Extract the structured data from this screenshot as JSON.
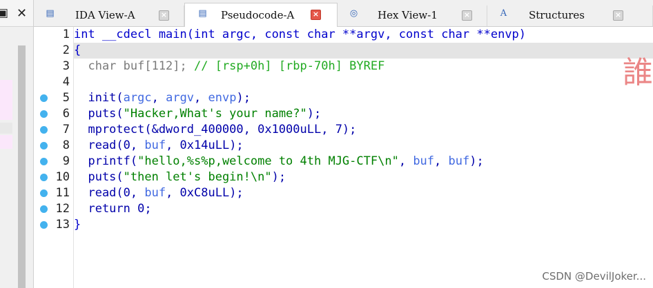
{
  "left_panel": {
    "pin_glyph": "▣",
    "close_glyph": "✕"
  },
  "tabs": [
    {
      "label": "IDA View-A",
      "icon": "ida-view-icon",
      "glyph": "▤",
      "active": false,
      "close": "×"
    },
    {
      "label": "Pseudocode-A",
      "icon": "pseudocode-icon",
      "glyph": "▤",
      "active": true,
      "close": "×"
    },
    {
      "label": "Hex View-1",
      "icon": "hex-view-icon",
      "glyph": "◎",
      "active": false,
      "close": "×"
    },
    {
      "label": "Structures",
      "icon": "structures-icon",
      "glyph": "A",
      "active": false,
      "close": "×"
    }
  ],
  "code_lines": [
    {
      "num": "1",
      "text": "int __cdecl main(int argc, const char **argv, const char **envp)",
      "bp": false,
      "kind": "plain"
    },
    {
      "num": "2",
      "text": "{",
      "bp": false,
      "kind": "plain"
    },
    {
      "num": "3",
      "text": "  char buf[112]; ",
      "comment": "// [rsp+0h] [rbp-70h] BYREF",
      "bp": false,
      "kind": "decl"
    },
    {
      "num": "4",
      "text": "",
      "bp": false,
      "kind": "plain"
    },
    {
      "num": "5",
      "text": "  init(argc, argv, envp);",
      "bp": true,
      "kind": "code"
    },
    {
      "num": "6",
      "text": "  puts(\"Hacker,What's your name?\");",
      "bp": true,
      "kind": "code"
    },
    {
      "num": "7",
      "text": "  mprotect(&dword_400000, 0x1000uLL, 7);",
      "bp": true,
      "kind": "code"
    },
    {
      "num": "8",
      "text": "  read(0, buf, 0x14uLL);",
      "bp": true,
      "kind": "code"
    },
    {
      "num": "9",
      "text": "  printf(\"hello,%s%p,welcome to 4th MJG-CTF\\n\", buf, buf);",
      "bp": true,
      "kind": "code"
    },
    {
      "num": "10",
      "text": "  puts(\"then let's begin!\\n\");",
      "bp": true,
      "kind": "code"
    },
    {
      "num": "11",
      "text": "  read(0, buf, 0xC8uLL);",
      "bp": true,
      "kind": "code"
    },
    {
      "num": "12",
      "text": "  return 0;",
      "bp": true,
      "kind": "code"
    },
    {
      "num": "13",
      "text": "}",
      "bp": true,
      "kind": "plain"
    }
  ],
  "watermark": "CSDN @DevilJoker...",
  "corner_glyph": "誰",
  "colors": {
    "breakpoint": "#43b2ee",
    "active_tab_close": "#e5574a",
    "string": "#008000",
    "keyword": "#000080",
    "comment": "#22aa22"
  }
}
